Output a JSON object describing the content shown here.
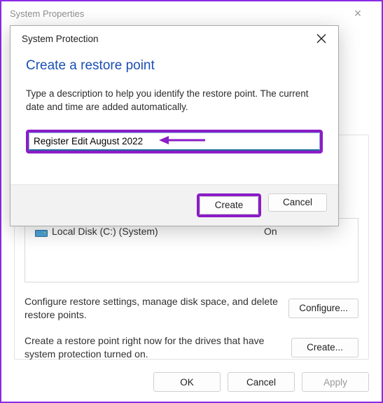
{
  "bg": {
    "title": "System Properties",
    "drive": {
      "name": "Local Disk (C:) (System)",
      "status": "On"
    },
    "config_text": "Configure restore settings, manage disk space, and delete restore points.",
    "config_button": "Configure...",
    "create_text": "Create a restore point right now for the drives that have system protection turned on.",
    "create_button": "Create...",
    "ok": "OK",
    "cancel": "Cancel",
    "apply": "Apply"
  },
  "dlg": {
    "title": "System Protection",
    "heading": "Create a restore point",
    "description": "Type a description to help you identify the restore point. The current date and time are added automatically.",
    "input_value": "Register Edit August 2022",
    "create": "Create",
    "cancel": "Cancel"
  }
}
